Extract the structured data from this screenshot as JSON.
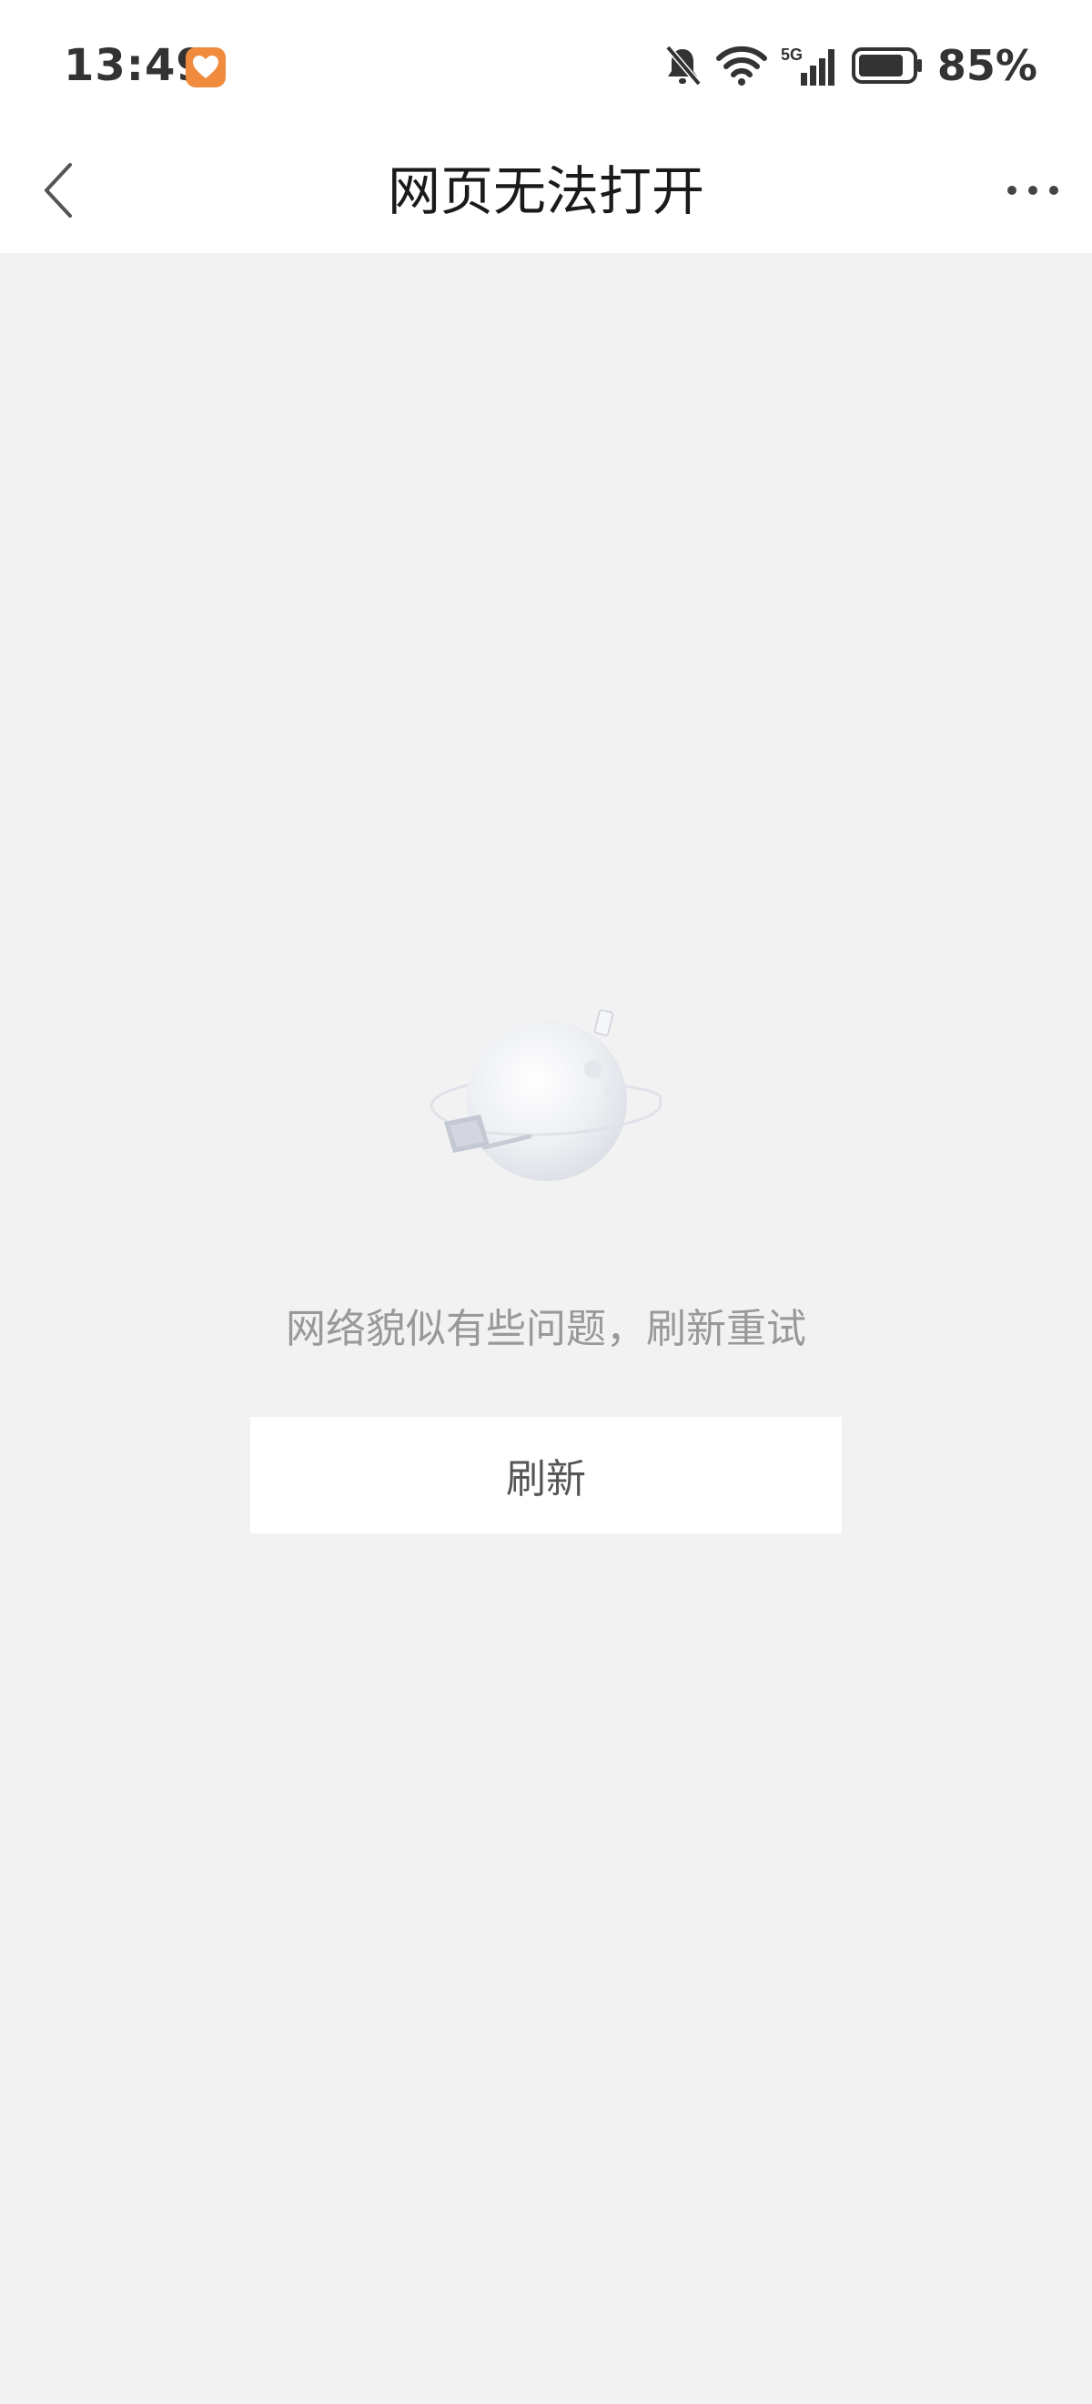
{
  "status_bar": {
    "time": "13:49",
    "app_badge_icon": "heart-app-icon",
    "icons": [
      "bell-mute-icon",
      "wifi-icon",
      "signal-5g-icon",
      "battery-icon"
    ],
    "network_label": "5G",
    "battery_percent": "85%",
    "battery_level": 0.85
  },
  "nav": {
    "back_icon": "chevron-left-icon",
    "title": "网页无法打开",
    "more_icon": "more-dots-icon"
  },
  "error": {
    "illustration": "planet-illustration",
    "message": "网络貌似有些问题，刷新重试",
    "refresh_label": "刷新"
  },
  "colors": {
    "background": "#f2f2f2",
    "bar": "#ffffff",
    "title": "#1a1a1a",
    "message": "#999999",
    "button_text": "#555555",
    "badge": "#f08a3c"
  }
}
